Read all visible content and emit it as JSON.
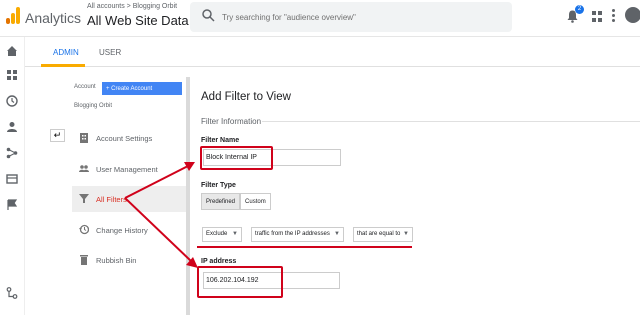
{
  "topbar": {
    "app_title": "Analytics",
    "breadcrumb": "All accounts > Blogging Orbit",
    "property_selector": "All Web Site Data",
    "search_placeholder": "Try searching for \"audience overview\"",
    "notification_count": "2"
  },
  "tabs": [
    {
      "label": "ADMIN",
      "active": true
    },
    {
      "label": "USER",
      "active": false
    }
  ],
  "account_panel": {
    "account_label": "Account",
    "create_account_label": "+ Create Account",
    "account_name": "Blogging Orbit",
    "back_icon": "back-arrow-icon",
    "items": [
      {
        "label": "Account Settings",
        "icon": "building-icon",
        "active": false
      },
      {
        "label": "User Management",
        "icon": "users-icon",
        "active": false
      },
      {
        "label": "All Filters",
        "icon": "filter-icon",
        "active": true
      },
      {
        "label": "Change History",
        "icon": "history-icon",
        "active": false
      },
      {
        "label": "Rubbish Bin",
        "icon": "trash-icon",
        "active": false
      }
    ]
  },
  "main": {
    "title": "Add Filter to View",
    "section_title": "Filter Information",
    "filter_name_label": "Filter Name",
    "filter_name_value": "Block Internal IP",
    "filter_type_label": "Filter Type",
    "filter_type_options": [
      "Predefined",
      "Custom"
    ],
    "filter_type_selected": "Predefined",
    "dropdowns": {
      "action": "Exclude",
      "source": "traffic from the IP addresses",
      "condition": "that are equal to"
    },
    "ip_address_label": "IP address",
    "ip_address_value": "106.202.104.192"
  },
  "colors": {
    "accent_blue": "#1a73e8",
    "admin_tab_underline": "#f9ab00",
    "annotation_red": "#d0021b",
    "active_menu_text": "#d93025"
  }
}
